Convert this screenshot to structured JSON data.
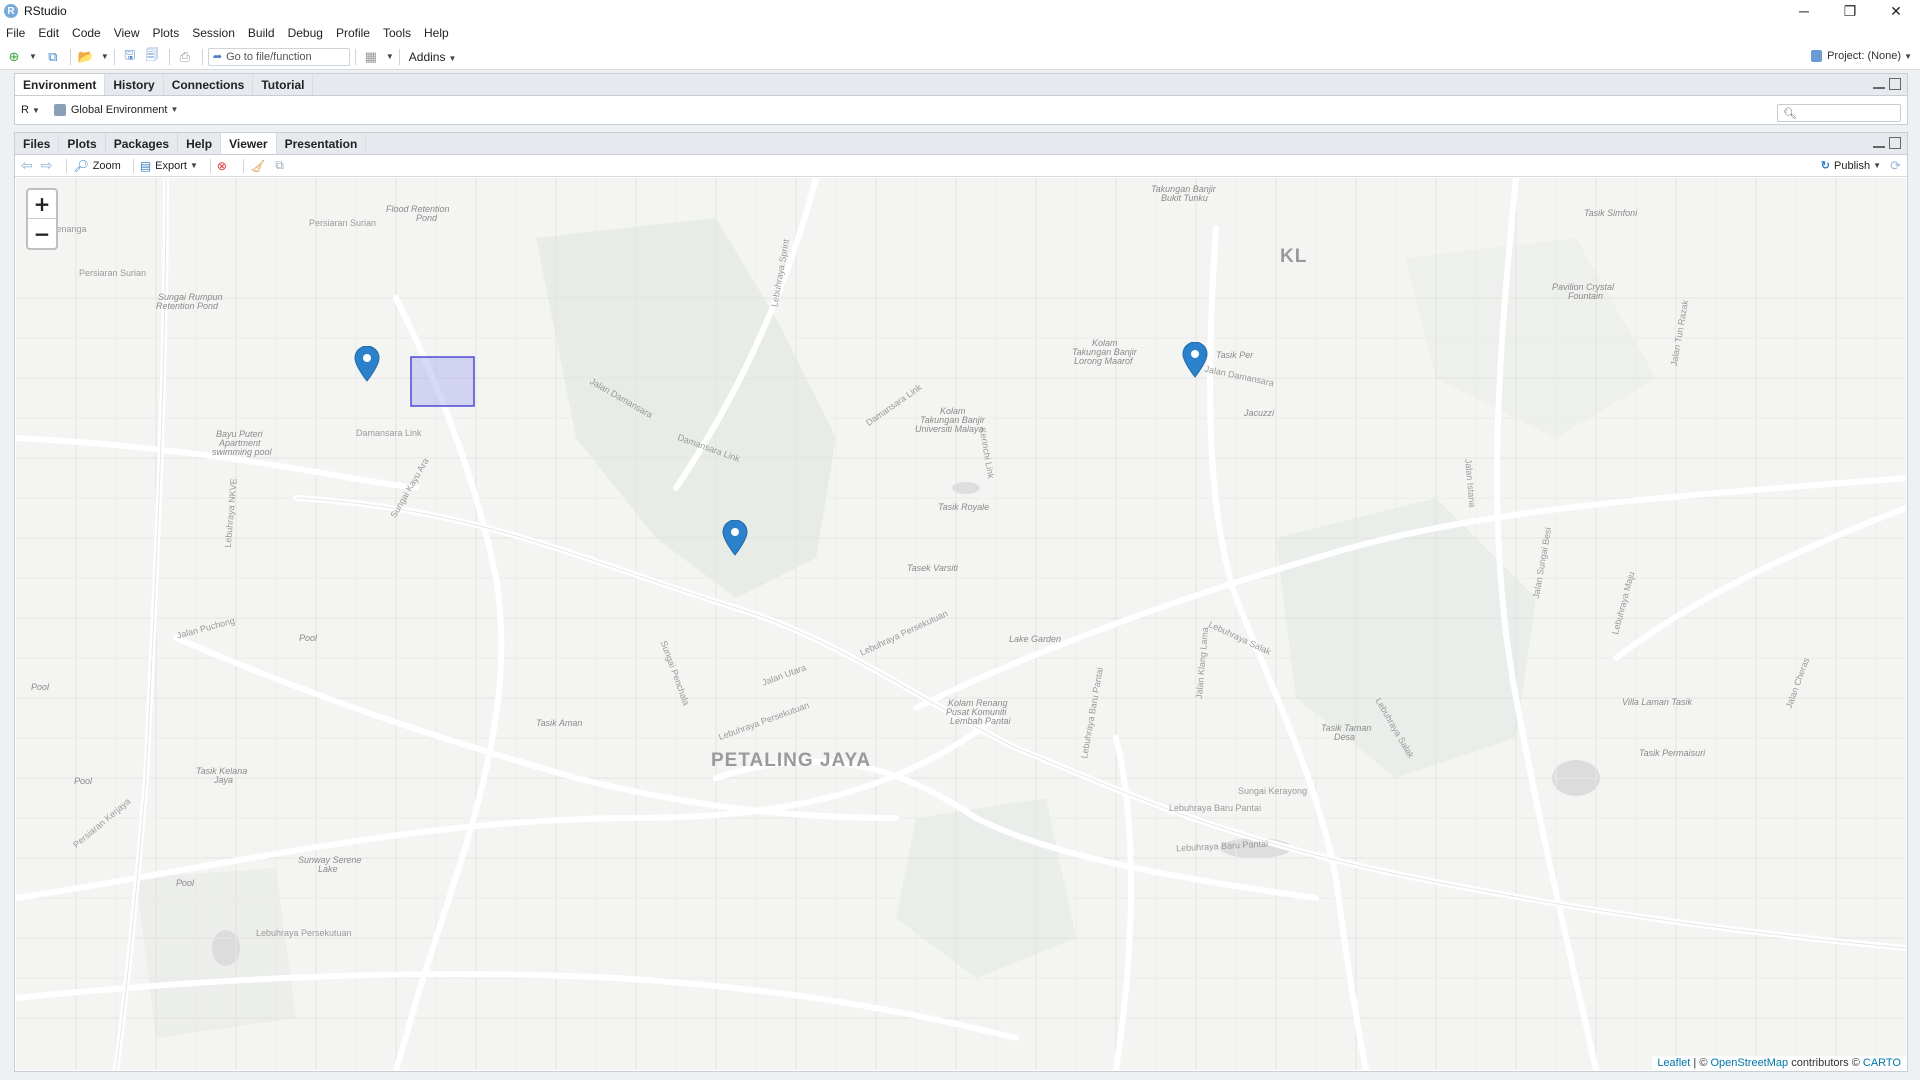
{
  "window": {
    "title": "RStudio",
    "controls": {
      "minimize": "─",
      "restore": "❐",
      "close": "✕"
    }
  },
  "menu": [
    "File",
    "Edit",
    "Code",
    "View",
    "Plots",
    "Session",
    "Build",
    "Debug",
    "Profile",
    "Tools",
    "Help"
  ],
  "toolbar": {
    "goto_placeholder": "Go to file/function",
    "addins_label": "Addins",
    "project_label": "Project: (None)"
  },
  "env_pane": {
    "tabs": [
      "Environment",
      "History",
      "Connections",
      "Tutorial"
    ],
    "active_tab": "Environment",
    "language": "R",
    "environment_select": "Global Environment"
  },
  "viewer_pane": {
    "tabs": [
      "Files",
      "Plots",
      "Packages",
      "Help",
      "Viewer",
      "Presentation"
    ],
    "active_tab": "Viewer",
    "zoom_label": "Zoom",
    "export_label": "Export",
    "publish_label": "Publish"
  },
  "map": {
    "zoom_in": "+",
    "zoom_out": "−",
    "attribution": {
      "leaflet": "Leaflet",
      "sep1": " | © ",
      "osm": "OpenStreetMap",
      "contrib": " contributors © ",
      "carto": "CARTO"
    },
    "marker_color": "#2b82cb",
    "rect_fill": "#a9a9f0",
    "rect_stroke": "#4b4bd6",
    "labels": {
      "kenanga": "an Kenanga",
      "persiaran_surian_1": "Persiaran Surian",
      "persiaran_surian_2": "Persiaran Surian",
      "flood_pond_1": "Flood Retention",
      "flood_pond_2": "Pond",
      "rumpun_1": "Sungai Rumpun",
      "rumpun_2": "Retention Pond",
      "bayu_1": "Bayu Puteri",
      "bayu_2": "Apartment",
      "bayu_3": "swimming pool",
      "damansara_link_1": "Damansara Link",
      "damansara_link_2": "Damansara Link",
      "damansara_link_3": "Damansara Link",
      "jalan_damansara_1": "Jalan Damansara",
      "jalan_damansara_2": "Jalan Damansara",
      "sungai_kayu_ara": "Sungai Kayu Ara",
      "nkve": "Lebuhraya NKVE",
      "sprint": "Lebuhraya Sprint",
      "takungan_tunku_1": "Takungan Banjir",
      "takungan_tunku_2": "Bukit Tunku",
      "kl": "KL",
      "tasik_simfoni": "Tasik Simfoni",
      "pavilion_1": "Pavilion Crystal",
      "pavilion_2": "Fountain",
      "kolam_maarof_1": "Kolam",
      "kolam_maarof_2": "Takungan Banjir",
      "kolam_maarof_3": "Lorong Maarof",
      "kolam_um_1": "Kolam",
      "kolam_um_2": "Takungan Banjir",
      "kolam_um_3": "Universiti Malaya",
      "tasik_perdana": "Tasik Per",
      "jacuzzi": "Jacuzzi",
      "tasik_royale": "Tasik Royale",
      "tasek_varsiti": "Tasek Varsiti",
      "lake_garden": "Lake Garden",
      "kolam_renang_1": "Kolam Renang",
      "kolam_renang_2": "Pusat Komuniti",
      "kolam_renang_3": "Lembah Pantai",
      "petaling_jaya": "PETALING JAYA",
      "tasik_aman": "Tasik Aman",
      "tasik_kelana_1": "Tasik Kelana",
      "tasik_kelana_2": "Jaya",
      "sunway_1": "Sunway Serene",
      "sunway_2": "Lake",
      "pool_1": "Pool",
      "pool_2": "Pool",
      "pool_3": "Pool",
      "pool_4": "Pool",
      "sungai_penchala": "Sungai Penchala",
      "jalan_utara": "Jalan Utara",
      "persekutuan_1": "Lebuhraya Persekutuan",
      "persekutuan_2": "Lebuhraya Persekutuan",
      "persekutuan_3": "Lebuhraya Persekutuan",
      "salak_1": "Lebuhraya Salak",
      "salak_2": "Lebuhraya Salak",
      "baru_pantai_1": "Lebuhraya Baru Pantai",
      "baru_pantai_2": "Lebuhraya Baru Pantai",
      "sungai_kerayong": "Sungai Kerayong",
      "villa_laman": "Villa Laman Tasik",
      "tasik_permaisuri": "Tasik Permaisuri",
      "tasik_taman_1": "Tasik Taman",
      "tasik_taman_2": "Desa",
      "jalan_istana": "Jalan Istana",
      "sungai_besi": "Jalan Sungai Besi",
      "jalan_puchong": "Jalan Puchong",
      "jalan_kerinchi": "Kerinchi Link",
      "jalan_tun_razak": "Jalan Tun Razak",
      "lebuhraya_maju": "Lebuhraya Maju",
      "jalan_cheras": "Jalan Cheras",
      "jalan_klang_lama": "Jalan Klang Lama",
      "jalan_syed_putra": "Lebuhraya Baru Pantai",
      "persiaran_kerjaya": "Persiaran Kerjaya"
    }
  }
}
